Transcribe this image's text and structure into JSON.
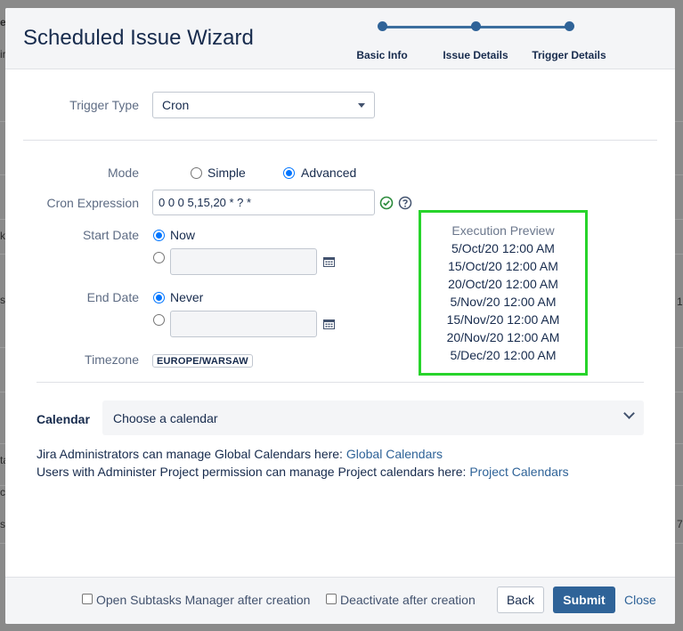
{
  "background": {
    "fragments": [
      "e",
      "ir",
      "k",
      "sl",
      "ta",
      "co",
      "s",
      "1",
      "7"
    ]
  },
  "dialog": {
    "title": "Scheduled Issue Wizard",
    "steps": [
      {
        "label": "Basic Info"
      },
      {
        "label": "Issue Details"
      },
      {
        "label": "Trigger Details"
      }
    ]
  },
  "trigger": {
    "label": "Trigger Type",
    "value": "Cron"
  },
  "mode": {
    "label": "Mode",
    "options": [
      {
        "label": "Simple",
        "selected": false
      },
      {
        "label": "Advanced",
        "selected": true
      }
    ]
  },
  "cron": {
    "label": "Cron Expression",
    "value": "0 0 0 5,15,20 * ? *",
    "valid_icon": "check-circle-icon",
    "help_icon": "question-circle-icon"
  },
  "start_date": {
    "label": "Start Date",
    "now_label": "Now",
    "now_selected": true,
    "date_value": ""
  },
  "end_date": {
    "label": "End Date",
    "never_label": "Never",
    "never_selected": true,
    "date_value": ""
  },
  "timezone": {
    "label": "Timezone",
    "value": "EUROPE/WARSAW"
  },
  "preview": {
    "title": "Execution Preview",
    "items": [
      "5/Oct/20 12:00 AM",
      "15/Oct/20 12:00 AM",
      "20/Oct/20 12:00 AM",
      "5/Nov/20 12:00 AM",
      "15/Nov/20 12:00 AM",
      "20/Nov/20 12:00 AM",
      "5/Dec/20 12:00 AM"
    ],
    "highlight_color": "#27d42b"
  },
  "calendar": {
    "label": "Calendar",
    "placeholder": "Choose a calendar",
    "global_text": "Jira Administrators can manage Global Calendars here: ",
    "global_link": "Global Calendars",
    "project_text": "Users with Administer Project permission can manage Project calendars here: ",
    "project_link": "Project Calendars"
  },
  "footer": {
    "open_subtasks_label": "Open Subtasks Manager after creation",
    "open_subtasks_checked": false,
    "deactivate_label": "Deactivate after creation",
    "deactivate_checked": false,
    "back_label": "Back",
    "submit_label": "Submit",
    "close_label": "Close"
  },
  "colors": {
    "primary": "#2f6398",
    "text": "#172b4d",
    "muted": "#5e6c84"
  }
}
